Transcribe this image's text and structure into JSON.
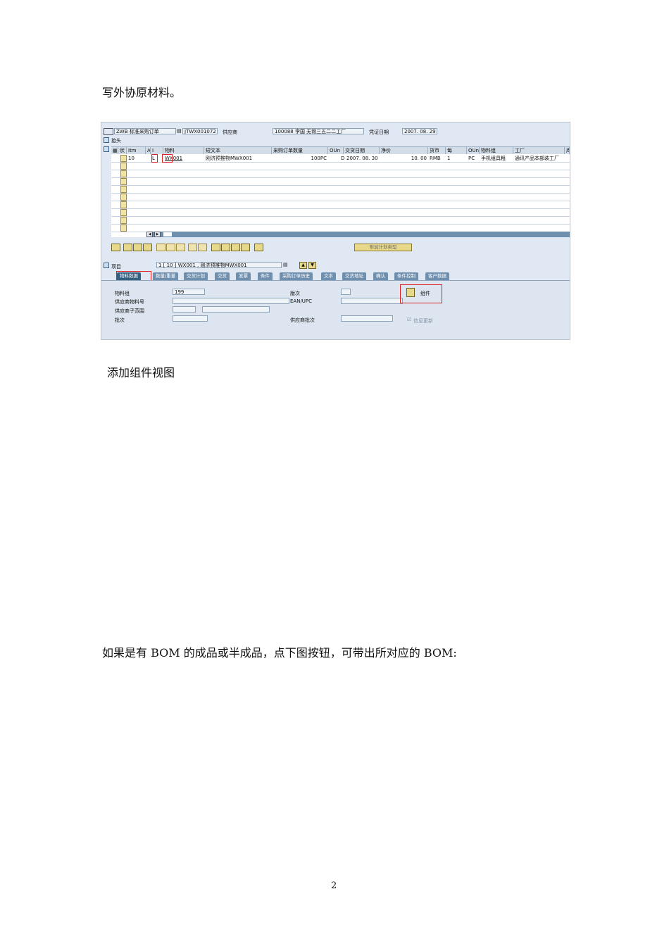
{
  "doc": {
    "para1": "写外协原材料。",
    "para2": "添加组件视图",
    "para3": "如果是有 BOM 的成品或半成品，点下图按钮，可带出所对应的 BOM:",
    "page_number": "2"
  },
  "sap": {
    "header": {
      "doc_type": "ZWB 标准采购订单",
      "po_number": "JTWX001072",
      "vendor_label": "供应商",
      "vendor_value": "100088 李国 无锡三五二二工厂",
      "date_label": "凭证日期",
      "date_value": "2007. 08. 29",
      "section_label": "抬头"
    },
    "grid": {
      "columns": [
        "状",
        "Itm",
        "A",
        "I",
        "物料",
        "短文本",
        "采购订单数量",
        "OUn",
        "交货日期",
        "净价",
        "货币",
        "每",
        "OUn",
        "物料组",
        "工厂",
        "库"
      ],
      "row1": [
        "10",
        "",
        "",
        "L",
        "WX001",
        "刚济预推物MWX001",
        "100PC",
        "D",
        "2007. 08. 30",
        "10. 00",
        "RMB",
        "1",
        "PC",
        "手机组具粗",
        "通讯产品本部装工厂"
      ]
    },
    "toolbar": {
      "plan_button": "附加计划类型"
    },
    "item": {
      "label": "项目",
      "value": "1 [ 10 ] WX001 , 刚济预推物MWX001"
    },
    "tabs": [
      "物料数据",
      "数量/重量",
      "交货计划",
      "交货",
      "发票",
      "条件",
      "采购订单历史",
      "文本",
      "交货地址",
      "确认",
      "条件控制",
      "客户数据"
    ],
    "detail": {
      "material_group_label": "物料组",
      "material_group_value": "199",
      "vendor_material_label": "供应商物料号",
      "vendor_subrange_label": "供应商子范围",
      "batch_label": "批次",
      "revision_label": "版次",
      "ean_label": "EAN/UPC",
      "vendor_batch_label": "供应商批次",
      "components_button": "组件",
      "info_update_label": "信息更新"
    }
  }
}
